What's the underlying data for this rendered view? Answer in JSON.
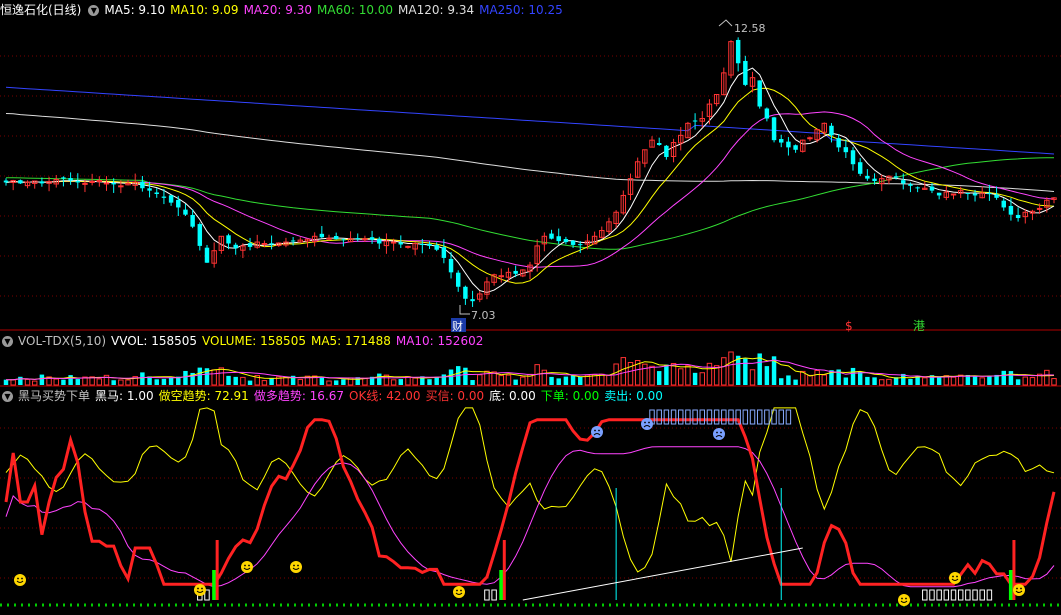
{
  "header_main": {
    "stock_name": "恒逸石化(日线)",
    "ma": [
      {
        "label": "MA5: 9.10",
        "color": "#ffffff"
      },
      {
        "label": "MA10: 9.09",
        "color": "#ffff00"
      },
      {
        "label": "MA20: 9.30",
        "color": "#ff44ff"
      },
      {
        "label": "MA60: 10.00",
        "color": "#33dd33"
      },
      {
        "label": "MA120: 9.34",
        "color": "#dddddd"
      },
      {
        "label": "MA250: 10.25",
        "color": "#3344ff"
      }
    ]
  },
  "header_vol": {
    "items": [
      {
        "label": "VOL-TDX(5,10)",
        "color": "#c0c0c0"
      },
      {
        "label": "VVOL: 158505",
        "color": "#ffffff"
      },
      {
        "label": "VOLUME: 158505",
        "color": "#ffff00"
      },
      {
        "label": "MA5: 171488",
        "color": "#ffff00"
      },
      {
        "label": "MA10: 152602",
        "color": "#ff44ff"
      }
    ]
  },
  "header_ind": {
    "items": [
      {
        "label": "黑马买势下单",
        "color": "#c0c0c0"
      },
      {
        "label": "黑马: 1.00",
        "color": "#ffffff"
      },
      {
        "label": "做空趋势: 72.91",
        "color": "#ffff00"
      },
      {
        "label": "做多趋势: 16.67",
        "color": "#ff44ff"
      },
      {
        "label": "OK线: 42.00",
        "color": "#ff3333"
      },
      {
        "label": "买信: 0.00",
        "color": "#ff3333"
      },
      {
        "label": "底: 0.00",
        "color": "#ffffff"
      },
      {
        "label": "下单: 0.00",
        "color": "#00ff00"
      },
      {
        "label": "卖出: 0.00",
        "color": "#00ffff"
      }
    ]
  },
  "annotations": {
    "high_label": "12.58",
    "low_label": "7.03",
    "event_cai": "财",
    "event_s": "$",
    "event_gang": "港"
  },
  "colors": {
    "up": "#ff3333",
    "down": "#00ffff",
    "grid": "#7a0000"
  },
  "chart_data": [
    {
      "type": "candlestick",
      "title": "恒逸石化(日线)",
      "price_range": [
        6.8,
        13.0
      ],
      "high": 12.58,
      "low": 7.03,
      "series": [
        {
          "name": "MA5",
          "value": 9.1
        },
        {
          "name": "MA10",
          "value": 9.09
        },
        {
          "name": "MA20",
          "value": 9.3
        },
        {
          "name": "MA60",
          "value": 10.0
        },
        {
          "name": "MA120",
          "value": 9.34
        },
        {
          "name": "MA250",
          "value": 10.25
        }
      ],
      "close": [
        9.62,
        9.66,
        9.6,
        9.63,
        9.65,
        9.6,
        9.64,
        9.68,
        9.7,
        9.66,
        9.62,
        9.6,
        9.64,
        9.66,
        9.61,
        9.58,
        9.55,
        9.6,
        9.63,
        9.5,
        9.45,
        9.38,
        9.3,
        9.2,
        9.1,
        8.95,
        8.7,
        8.3,
        7.95,
        8.2,
        8.5,
        8.35,
        8.25,
        8.3,
        8.28,
        8.38,
        8.35,
        8.33,
        8.36,
        8.38,
        8.4,
        8.42,
        8.44,
        8.5,
        8.48,
        8.46,
        8.44,
        8.42,
        8.45,
        8.44,
        8.45,
        8.43,
        8.35,
        8.4,
        8.38,
        8.33,
        8.29,
        8.35,
        8.32,
        8.3,
        8.22,
        8.05,
        7.75,
        7.45,
        7.2,
        7.15,
        7.3,
        7.55,
        7.7,
        7.68,
        7.75,
        7.72,
        7.8,
        7.9,
        8.3,
        8.5,
        8.45,
        8.4,
        8.38,
        8.32,
        8.33,
        8.4,
        8.5,
        8.62,
        8.8,
        9.0,
        9.35,
        9.7,
        10.05,
        10.3,
        10.5,
        10.4,
        10.15,
        10.45,
        10.6,
        10.85,
        10.9,
        10.95,
        11.25,
        11.45,
        11.9,
        12.55,
        12.1,
        11.65,
        11.8,
        11.2,
        10.95,
        10.5,
        10.45,
        10.35,
        10.3,
        10.5,
        10.55,
        10.72,
        10.85,
        10.6,
        10.35,
        10.25,
        10.0,
        9.8,
        9.7,
        9.65,
        9.7,
        9.75,
        9.72,
        9.6,
        9.55,
        9.5,
        9.5,
        9.45,
        9.35,
        9.42,
        9.38,
        9.45,
        9.4,
        9.35,
        9.4,
        9.38,
        9.3,
        9.1,
        8.95,
        8.88,
        9.0,
        9.02,
        9.08,
        9.25,
        9.3
      ]
    },
    {
      "type": "bar",
      "title": "VOL-TDX(5,10)",
      "series": [
        {
          "name": "VVOL",
          "value": 158505
        },
        {
          "name": "VOLUME",
          "value": 158505
        },
        {
          "name": "MA5",
          "value": 171488
        },
        {
          "name": "MA10",
          "value": 152602
        }
      ]
    },
    {
      "type": "line",
      "title": "黑马买势下单",
      "series": [
        {
          "name": "黑马",
          "value": 1.0
        },
        {
          "name": "做空趋势",
          "value": 72.91
        },
        {
          "name": "做多趋势",
          "value": 16.67
        },
        {
          "name": "OK线",
          "value": 42.0
        },
        {
          "name": "买信",
          "value": 0.0
        },
        {
          "name": "底",
          "value": 0.0
        },
        {
          "name": "下单",
          "value": 0.0
        },
        {
          "name": "卖出",
          "value": 0.0
        }
      ]
    }
  ]
}
